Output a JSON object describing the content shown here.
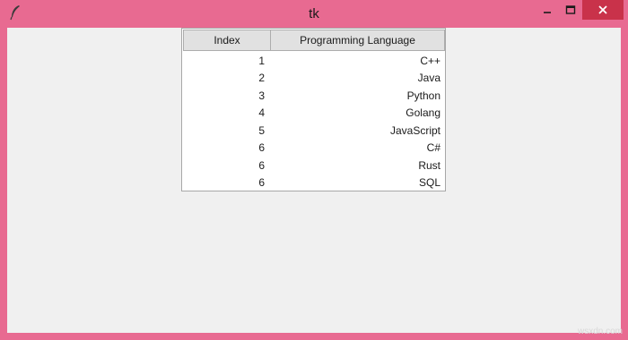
{
  "window": {
    "title": "tk",
    "icon": "feather-icon"
  },
  "table": {
    "columns": [
      "Index",
      "Programming Language"
    ],
    "rows": [
      {
        "index": "1",
        "language": "C++"
      },
      {
        "index": "2",
        "language": "Java"
      },
      {
        "index": "3",
        "language": "Python"
      },
      {
        "index": "4",
        "language": "Golang"
      },
      {
        "index": "5",
        "language": "JavaScript"
      },
      {
        "index": "6",
        "language": "C#"
      },
      {
        "index": "6",
        "language": "Rust"
      },
      {
        "index": "6",
        "language": "SQL"
      }
    ]
  },
  "watermark": "wsxdn.com",
  "colors": {
    "frame": "#e86a91",
    "close_button": "#c9324a",
    "client_bg": "#f0f0f0"
  }
}
